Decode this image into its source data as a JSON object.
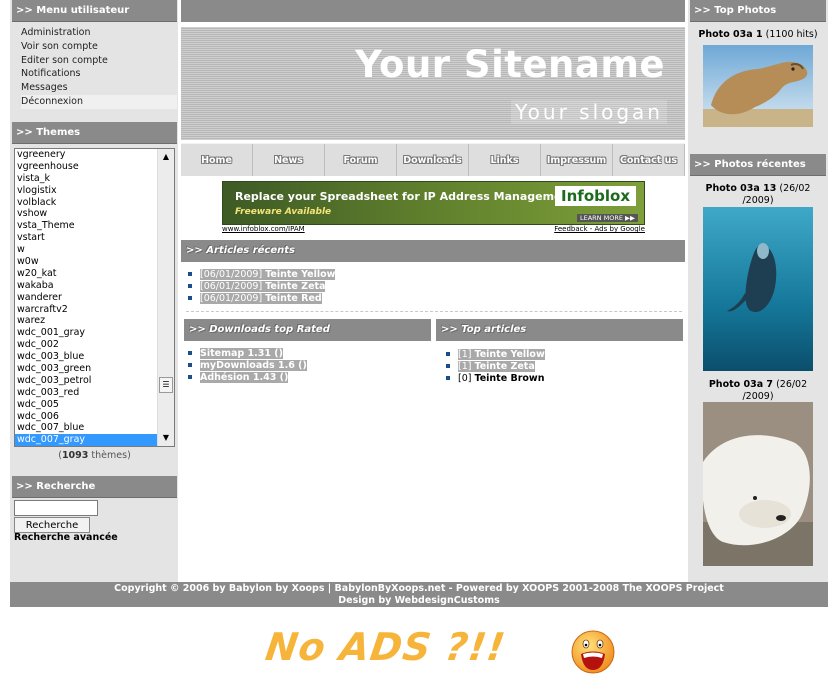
{
  "menu": {
    "title": ">> Menu utilisateur",
    "items": [
      "Administration",
      "Voir son compte",
      "Editer son compte",
      "Notifications",
      "Messages",
      "Déconnexion"
    ]
  },
  "themes": {
    "title": ">> Themes",
    "options": [
      "vgreenery",
      "vgreenhouse",
      "vista_k",
      "vlogistix",
      "volblack",
      "vshow",
      "vsta_Theme",
      "vstart",
      "w",
      "w0w",
      "w20_kat",
      "wakaba",
      "wanderer",
      "warcraftv2",
      "warez",
      "wdc_001_gray",
      "wdc_002",
      "wdc_003_blue",
      "wdc_003_green",
      "wdc_003_petrol",
      "wdc_003_red",
      "wdc_005",
      "wdc_006",
      "wdc_007_blue",
      "wdc_007_gray"
    ],
    "selected": "wdc_007_gray",
    "count": "1093",
    "count_suffix": "thèmes"
  },
  "search": {
    "title": ">> Recherche",
    "button": "Recherche",
    "advanced": "Recherche avancée"
  },
  "header": {
    "sitename": "Your Sitename",
    "slogan": "Your slogan"
  },
  "nav": [
    "Home",
    "News",
    "Forum",
    "Downloads",
    "Links",
    "Impressum",
    "Contact us"
  ],
  "ad": {
    "title": "Replace your Spreadsheet for IP Address Management",
    "subtitle": "Freeware Available",
    "brand": "Infoblox",
    "learn": "LEARN MORE ▶▶",
    "url": "www.infoblox.com/IPAM",
    "feedback": "Feedback - Ads by Google"
  },
  "recent_articles": {
    "title": ">> Articles récents",
    "items": [
      {
        "date": "[06/01/2009]",
        "name": "Teinte Yellow"
      },
      {
        "date": "[06/01/2009]",
        "name": "Teinte Zeta"
      },
      {
        "date": "[06/01/2009]",
        "name": "Teinte Red"
      }
    ]
  },
  "downloads": {
    "title": ">> Downloads top Rated",
    "items": [
      "Sitemap 1.31 ()",
      "myDownloads 1.6 ()",
      "Adhésion 1.43 ()"
    ]
  },
  "top_articles": {
    "title": ">> Top articles",
    "items": [
      {
        "count": "[1]",
        "name": "Teinte Yellow",
        "highlight": true
      },
      {
        "count": "[1]",
        "name": "Teinte Zeta",
        "highlight": true
      },
      {
        "count": "[0]",
        "name": "Teinte Brown",
        "highlight": false
      }
    ]
  },
  "top_photos": {
    "title": ">> Top Photos",
    "photo": {
      "name": "Photo 03a 1",
      "meta": "(1100 hits)"
    }
  },
  "recent_photos": {
    "title": ">> Photos récentes",
    "photos": [
      {
        "name": "Photo 03a 13",
        "meta": "(26/02 /2009)"
      },
      {
        "name": "Photo 03a 7",
        "meta": "(26/02 /2009)"
      }
    ]
  },
  "footer": {
    "line1": "Copyright © 2006 by Babylon by Xoops  |  BabylonByXoops.net - Powered by XOOPS 2001-2008 The XOOPS Project",
    "line2": "Design by WebdesignCustoms"
  },
  "overlay": {
    "noads": "No ADS ?!!"
  },
  "colors": {
    "block_header": "#8a8a8a",
    "selection": "#3399ff",
    "bullet": "#1d4e8c",
    "noads": "#f6b43a"
  }
}
